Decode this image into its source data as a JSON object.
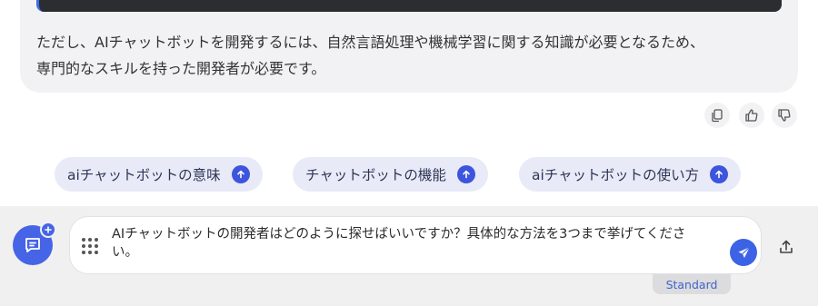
{
  "message": {
    "lines": [
      "ただし、AIチャットボットを開発するには、自然言語処理や機械学習に関する知識が必要となるため、",
      "専門的なスキルを持った開発者が必要です。"
    ]
  },
  "feedback": {
    "icons": [
      "copy-icon",
      "thumbs-up-icon",
      "thumbs-down-icon"
    ]
  },
  "suggestions": [
    {
      "label": "aiチャットボットの意味"
    },
    {
      "label": "チャットボットの機能"
    },
    {
      "label": "aiチャットボットの使い方"
    }
  ],
  "input": {
    "value": "AIチャットボットの開発者はどのように探せばいいですか？具体的な方法を3つまで挙げてください。"
  },
  "model_badge": "Standard",
  "colors": {
    "accent": "#3c55dc",
    "chip_bg": "#e8eaf8",
    "card_bg": "#f2f2f4",
    "bar_bg": "#f0f0f0"
  }
}
